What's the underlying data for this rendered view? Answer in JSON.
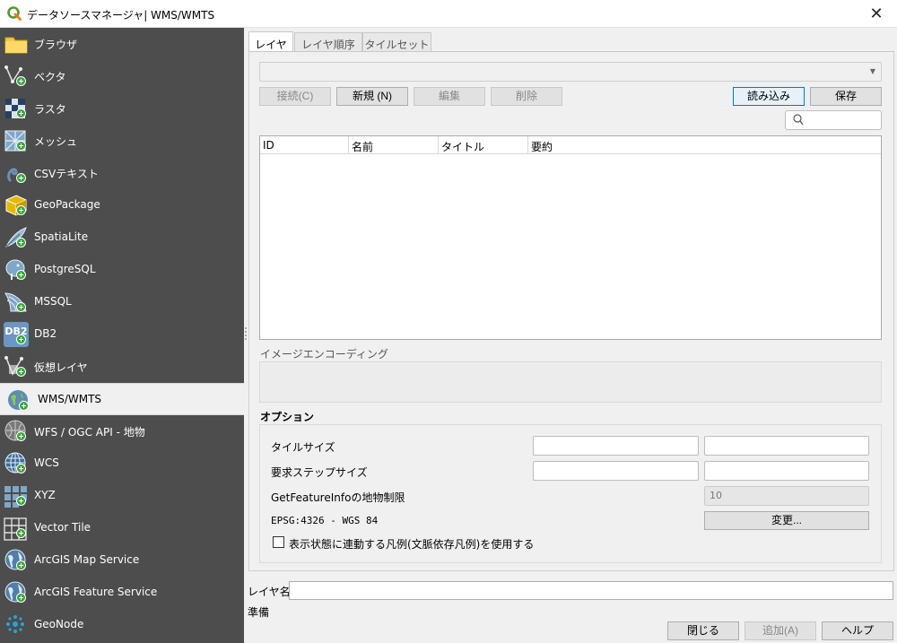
{
  "window": {
    "title": "データソースマネージャ| WMS/WMTS",
    "close_glyph": "✕"
  },
  "sidebar": {
    "items": [
      {
        "label": "ブラウザ",
        "icon": "folder-icon"
      },
      {
        "label": "ベクタ",
        "icon": "vector-icon"
      },
      {
        "label": "ラスタ",
        "icon": "raster-icon"
      },
      {
        "label": "メッシュ",
        "icon": "mesh-icon"
      },
      {
        "label": "CSVテキスト",
        "icon": "csv-icon"
      },
      {
        "label": "GeoPackage",
        "icon": "geopackage-icon"
      },
      {
        "label": "SpatiaLite",
        "icon": "spatialite-icon"
      },
      {
        "label": "PostgreSQL",
        "icon": "postgresql-icon"
      },
      {
        "label": "MSSQL",
        "icon": "mssql-icon"
      },
      {
        "label": "DB2",
        "icon": "db2-icon"
      },
      {
        "label": "仮想レイヤ",
        "icon": "virtual-layer-icon"
      },
      {
        "label": "WMS/WMTS",
        "icon": "wms-icon",
        "active": true
      },
      {
        "label": "WFS / OGC API - 地物",
        "icon": "wfs-icon"
      },
      {
        "label": "WCS",
        "icon": "wcs-icon"
      },
      {
        "label": "XYZ",
        "icon": "xyz-icon"
      },
      {
        "label": "Vector Tile",
        "icon": "vector-tile-icon"
      },
      {
        "label": "ArcGIS Map Service",
        "icon": "arcgis-map-icon"
      },
      {
        "label": "ArcGIS Feature Service",
        "icon": "arcgis-feature-icon"
      },
      {
        "label": "GeoNode",
        "icon": "geonode-icon"
      }
    ],
    "db2_badge": "DB2"
  },
  "tabs": [
    {
      "label": "レイヤ",
      "active": true
    },
    {
      "label": "レイヤ順序"
    },
    {
      "label": "タイルセット"
    }
  ],
  "connection": {
    "selected": "",
    "buttons": {
      "connect": "接続(C)",
      "new": "新規 (N)",
      "edit": "編集",
      "delete": "削除",
      "load": "読み込み",
      "save": "保存"
    }
  },
  "layer_table": {
    "columns": [
      "ID",
      "名前",
      "タイトル",
      "要約"
    ],
    "rows": []
  },
  "image_encoding": {
    "label": "イメージエンコーディング"
  },
  "options": {
    "label": "オプション",
    "tile_size_label": "タイルサイズ",
    "tile_size_w": "",
    "tile_size_h": "",
    "step_size_label": "要求ステップサイズ",
    "step_size_w": "",
    "step_size_h": "",
    "feature_info_label": "GetFeatureInfoの地物制限",
    "feature_info_value": "10",
    "crs_label": "EPSG:4326 - WGS 84",
    "change_button": "変更...",
    "legend_checkbox_label": "表示状態に連動する凡例(文脈依存凡例)を使用する"
  },
  "layer_name": {
    "label": "レイヤ名",
    "value": ""
  },
  "status": "準備",
  "footer_buttons": {
    "close": "閉じる",
    "add": "追加(A)",
    "help": "ヘルプ"
  },
  "colors": {
    "sidebar_bg": "#4d4d4d",
    "focus_border": "#0078d7",
    "qgis_green": "#589632",
    "plus_green": "#3ea33e"
  }
}
